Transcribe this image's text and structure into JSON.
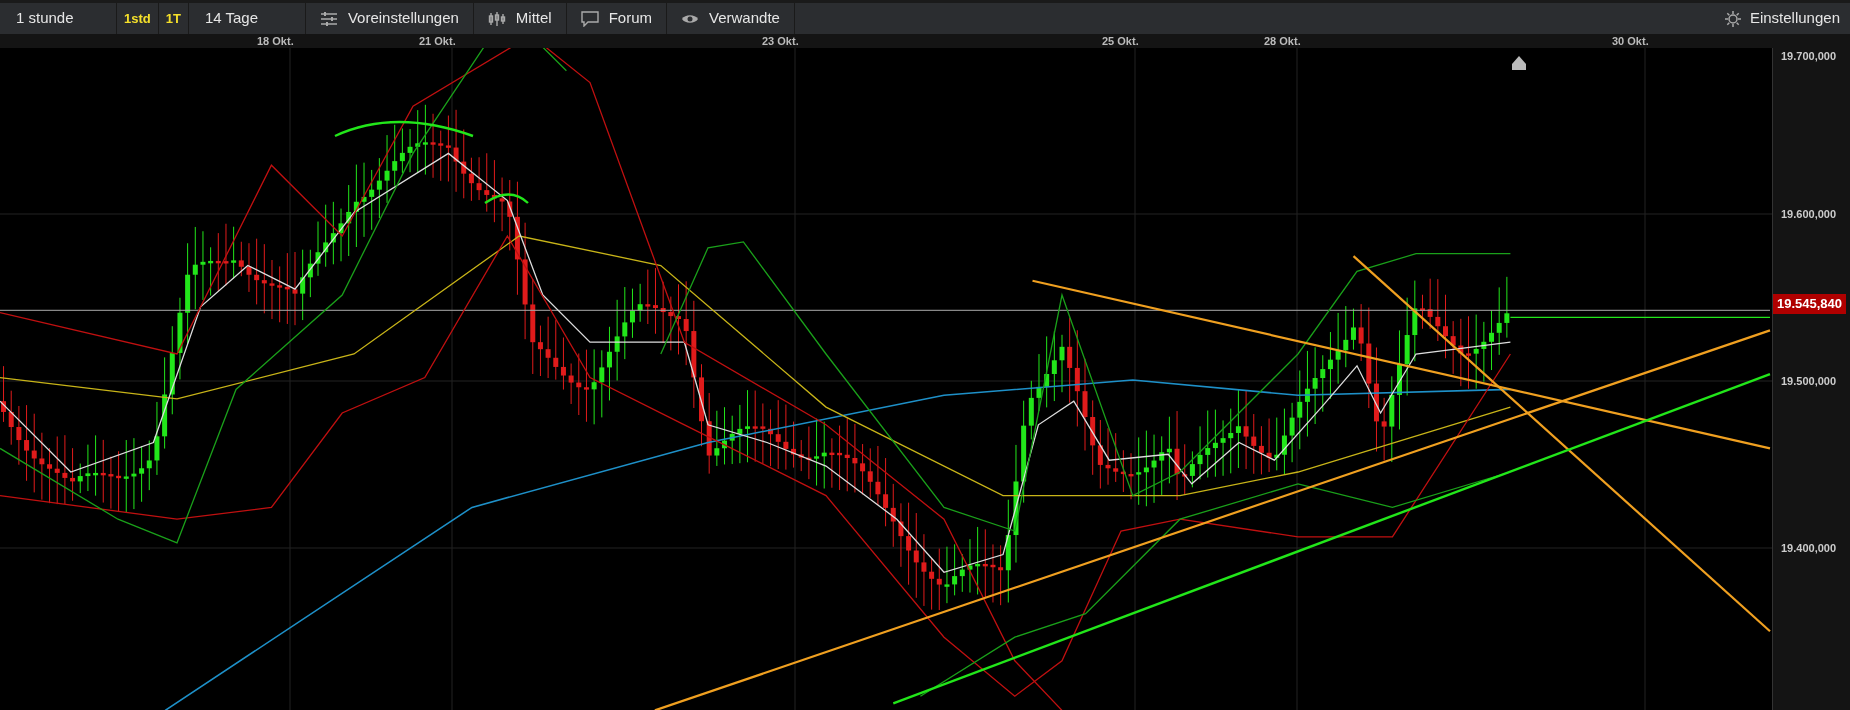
{
  "toolbar": {
    "items": [
      {
        "kind": "dropdown",
        "label": "1 stunde"
      },
      {
        "kind": "quick",
        "label": "1std"
      },
      {
        "kind": "quick",
        "label": "1T"
      },
      {
        "kind": "dropdown",
        "label": "14 Tage"
      },
      {
        "kind": "presets",
        "label": "Voreinstellungen"
      },
      {
        "kind": "studies",
        "label": "Mittel"
      },
      {
        "kind": "forum",
        "label": "Forum"
      },
      {
        "kind": "related",
        "label": "Verwandte"
      }
    ],
    "settings": {
      "label": "Einstellungen"
    }
  },
  "chart": {
    "dates": [
      "18 Okt.",
      "21 Okt.",
      "23 Okt.",
      "25 Okt.",
      "28 Okt.",
      "30 Okt."
    ],
    "price_ticks": [
      "19.700,000",
      "19.600,000",
      "19.500,000",
      "19.400,000"
    ],
    "last_price": "19.545,840"
  }
}
